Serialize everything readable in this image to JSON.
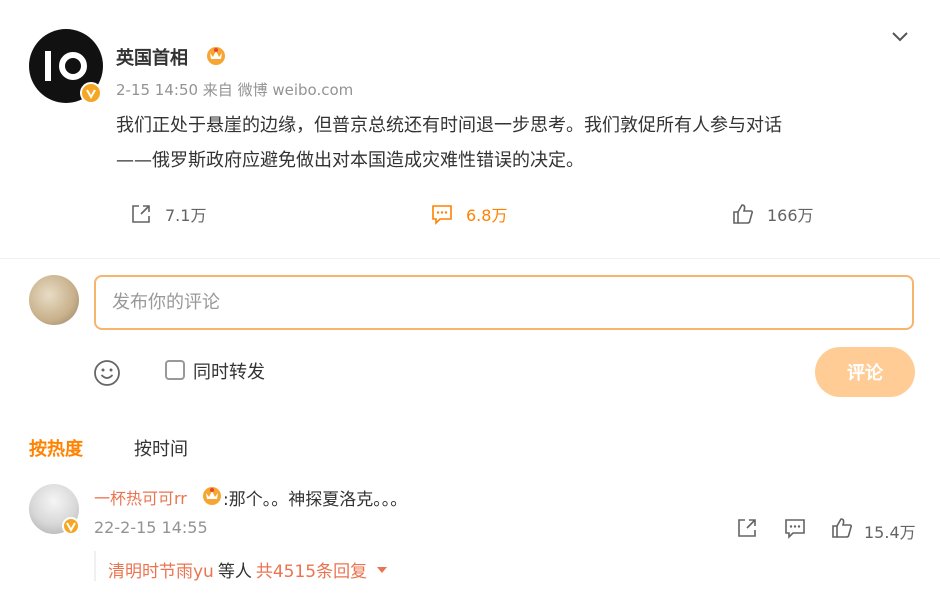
{
  "post": {
    "author": "英国首相",
    "avatar_text": "IO",
    "meta": "2-15 14:50  来自 微博 weibo.com",
    "text_line1": "我们正处于悬崖的边缘，但普京总统还有时间退一步思考。我们敦促所有人参与对话",
    "text_line2": "——俄罗斯政府应避免做出对本国造成灾难性错误的决定。",
    "actions": {
      "repost": "7.1万",
      "comment": "6.8万",
      "like": "166万"
    }
  },
  "composer": {
    "placeholder": "发布你的评论",
    "repost_label": "同时转发",
    "submit_label": "评论"
  },
  "sort": {
    "hot": "按热度",
    "time": "按时间"
  },
  "comment": {
    "user": "一杯热可可rr",
    "text": ":那个。。神探夏洛克。。。",
    "time": "22-2-15 14:55",
    "likes": "15.4万",
    "reply_user": "清明时节雨yu",
    "reply_mid": "等人",
    "reply_count": "共4515条回复"
  },
  "colors": {
    "accent": "#ff8200",
    "username": "#eb7350",
    "submit_bg": "#ffcc96",
    "input_border": "#f7b46e"
  }
}
